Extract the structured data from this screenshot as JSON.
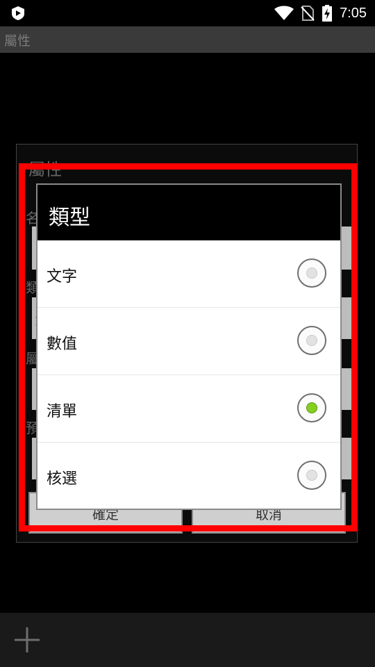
{
  "status_bar": {
    "time": "7:05",
    "icons": [
      "app-shield-icon",
      "wifi-icon",
      "no-sim-icon",
      "battery-charging-icon"
    ]
  },
  "app_bar": {
    "title": "屬性"
  },
  "background_dialog": {
    "title": "屬性",
    "label_fragments": [
      "名",
      "類",
      "屬",
      "預"
    ],
    "field_fragments": [
      "",
      "清",
      "",
      "",
      "",
      ""
    ],
    "confirm_button": "確定",
    "cancel_button": "取消"
  },
  "type_dialog": {
    "title": "類型",
    "options": [
      {
        "label": "文字",
        "selected": false
      },
      {
        "label": "數值",
        "selected": false
      },
      {
        "label": "清單",
        "selected": true
      },
      {
        "label": "核選",
        "selected": false
      }
    ]
  },
  "bottom_bar": {
    "icon": "add-icon"
  },
  "colors": {
    "highlight": "#ff0000",
    "radio_selected": "#86cf1f"
  }
}
